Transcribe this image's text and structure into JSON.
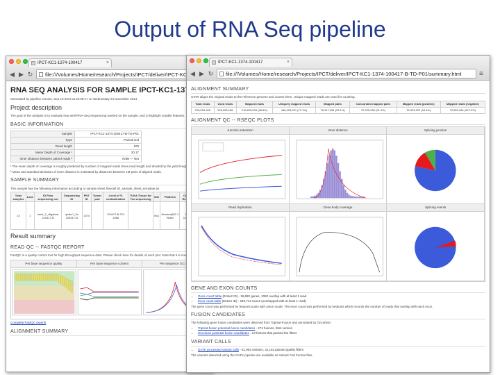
{
  "slide": {
    "title": "Output of RNA Seq pipeline"
  },
  "left_window": {
    "tab_title": "IPCT-KC1-1374-100417",
    "url": "file:///Volumes/Home/research/Projects/IPCT/deliver/IPCT-KC1-1374-100",
    "report_title": "RNA SEQ ANALYSIS FOR SAMPLE IPCT-KC1-1374",
    "generated_line": "Generated by pipeline version, Sep 10 2014 at 23:09:17 on Wednesday 24 November 2014",
    "project_description": "Project description",
    "project_text": "The goal of the analysis is to evaluate how well RNA-Seq sequencing worked on the sample, and to highlight notable features. ",
    "basic_info_heading": "BASIC INFORMATION",
    "basic_info": [
      {
        "key": "Sample",
        "value": "IPCT-KC1-1374-100417-B-TD-P01"
      },
      {
        "key": "Type",
        "value": "Paired end"
      },
      {
        "key": "Read length",
        "value": "100"
      },
      {
        "key": "Mean Depth of Coverage ¹",
        "value": "20.17"
      },
      {
        "key": "Inner distance between paired reads ²",
        "value": "N/aN +- N/a"
      }
    ],
    "footnote1": "¹ The mean depth of coverage is roughly predicted by number of mapped reads times read length and divided by the yield length of exons.",
    "footnote2": "² Mean and standard deviation of inner distance is estimated by distances between 1M pairs of aligned reads.",
    "sample_summary_heading": "SAMPLE SUMMARY",
    "sample_summary_text": "This sample has the following information according to sample sheet flowcell ID_sample_sheet_template.txt",
    "grid_headers": [
      "Total samples",
      "Lane",
      "ID Flow sequencing run",
      "Sequencing ID",
      "PNT ID",
      "Tumor part",
      "Level of % contamination",
      "TUNA Tissue for Tox sequencing",
      "Site",
      "Platform",
      "Capture Reagents",
      "Run Type"
    ],
    "grid_row": [
      "13",
      "1",
      "hacb_2_c5gabrar 100417-B",
      "ipctkc1_5n 100417-B",
      "1374",
      "",
      "100417-B 374 1066",
      "",
      "N/A",
      "Nextseq500 1 Hidex",
      "Kapa 1234566",
      "Paired"
    ],
    "result_summary": "Result summary",
    "read_qc_heading": "READ QC -- FASTQC REPORT",
    "read_qc_text": "FastQC is a quality control tool for high throughput sequence data. Please check here for details of each plot. Note that it is normal",
    "plot_headers": [
      "Per base sequence quality",
      "Per base sequence content",
      "Per sequence GC con"
    ],
    "complete_link": "Complete FastQC reports",
    "alignment_summary_left": "ALIGNMENT SUMMARY"
  },
  "right_window": {
    "tab_title": "IPCT-KC1-1374-100417",
    "url": "file:///Volumes/Home/research/Projects/IPCT/deliver/IPCT-KC1-1374-100417-B-TD-P01/summary.html",
    "alignment_heading": "ALIGNMENT SUMMARY",
    "alignment_text": "STAR aligns the original reads to the reference genome and counts them. Unique mapped reads are used for counting.",
    "align_headers": [
      "Total reads",
      "Used reads",
      "Mapped reads",
      "Uniquely mapped reads",
      "Mapped pairs",
      "Concordant mapped pairs",
      "Mapped reads (positive)",
      "Mapped reads (negative)"
    ],
    "align_values": [
      "226,053,168",
      "226,053,168",
      "216,625,534 (95.8%)",
      "185,225,321 (71.1%)",
      "76,417,954 (93.1%)",
      "72,225,936 (91.4%)",
      "76,993,322 (94.4%)",
      "72,820,284 (92.13%)"
    ],
    "rseqc_heading": "ALIGNMENT QC -- RSEQC PLOTS",
    "plot_headers_row1": [
      "Junction saturation",
      "Inner distance",
      "Splicing junction"
    ],
    "plot_headers_row2": [
      "Read duplication",
      "Gene body coverage",
      "Splicing events"
    ],
    "gene_exon_heading": "GENE AND EXON COUNTS",
    "gene_links": [
      {
        "link": "Gene count table",
        "suffix": " (Entrez ID) - 19,682 genes, 1082 overlap with at least 1 read"
      },
      {
        "link": "Exon count table",
        "suffix": " (Entrez ID) - 348,714 exons (overlapped with at least 1 read)"
      }
    ],
    "gene_text": "The gene count was performed by featureCounts with union mode. The exon count was performed by bedtools which records the number of reads that overlap with each exon.",
    "fusion_heading": "FUSION CANDIDATES",
    "fusion_text": "The following gene fusion candidates were detected from TopHat-Fusion and annotated by Oncofuse:",
    "fusion_links": [
      {
        "link": "TopHat-fusion potential fusion candidates",
        "suffix": " - 274 fusions, html version"
      },
      {
        "link": "Oncofuse potential fusion candidates",
        "suffix": " - 24 fusions that passed the filters"
      }
    ],
    "variant_heading": "VARIANT CALLS",
    "variant_links": [
      {
        "link": "GATK processed variant calls",
        "suffix": " - 51,903 variants, 31,153 passed quality filters"
      }
    ],
    "variant_text": "The variants detected using the GATK pipeline are available as Variant Call Format files."
  },
  "chart_colors": {
    "red": "#e41a1c",
    "green": "#4daf4a",
    "blue": "#3b5bdb",
    "purple": "#9b8fd6"
  }
}
